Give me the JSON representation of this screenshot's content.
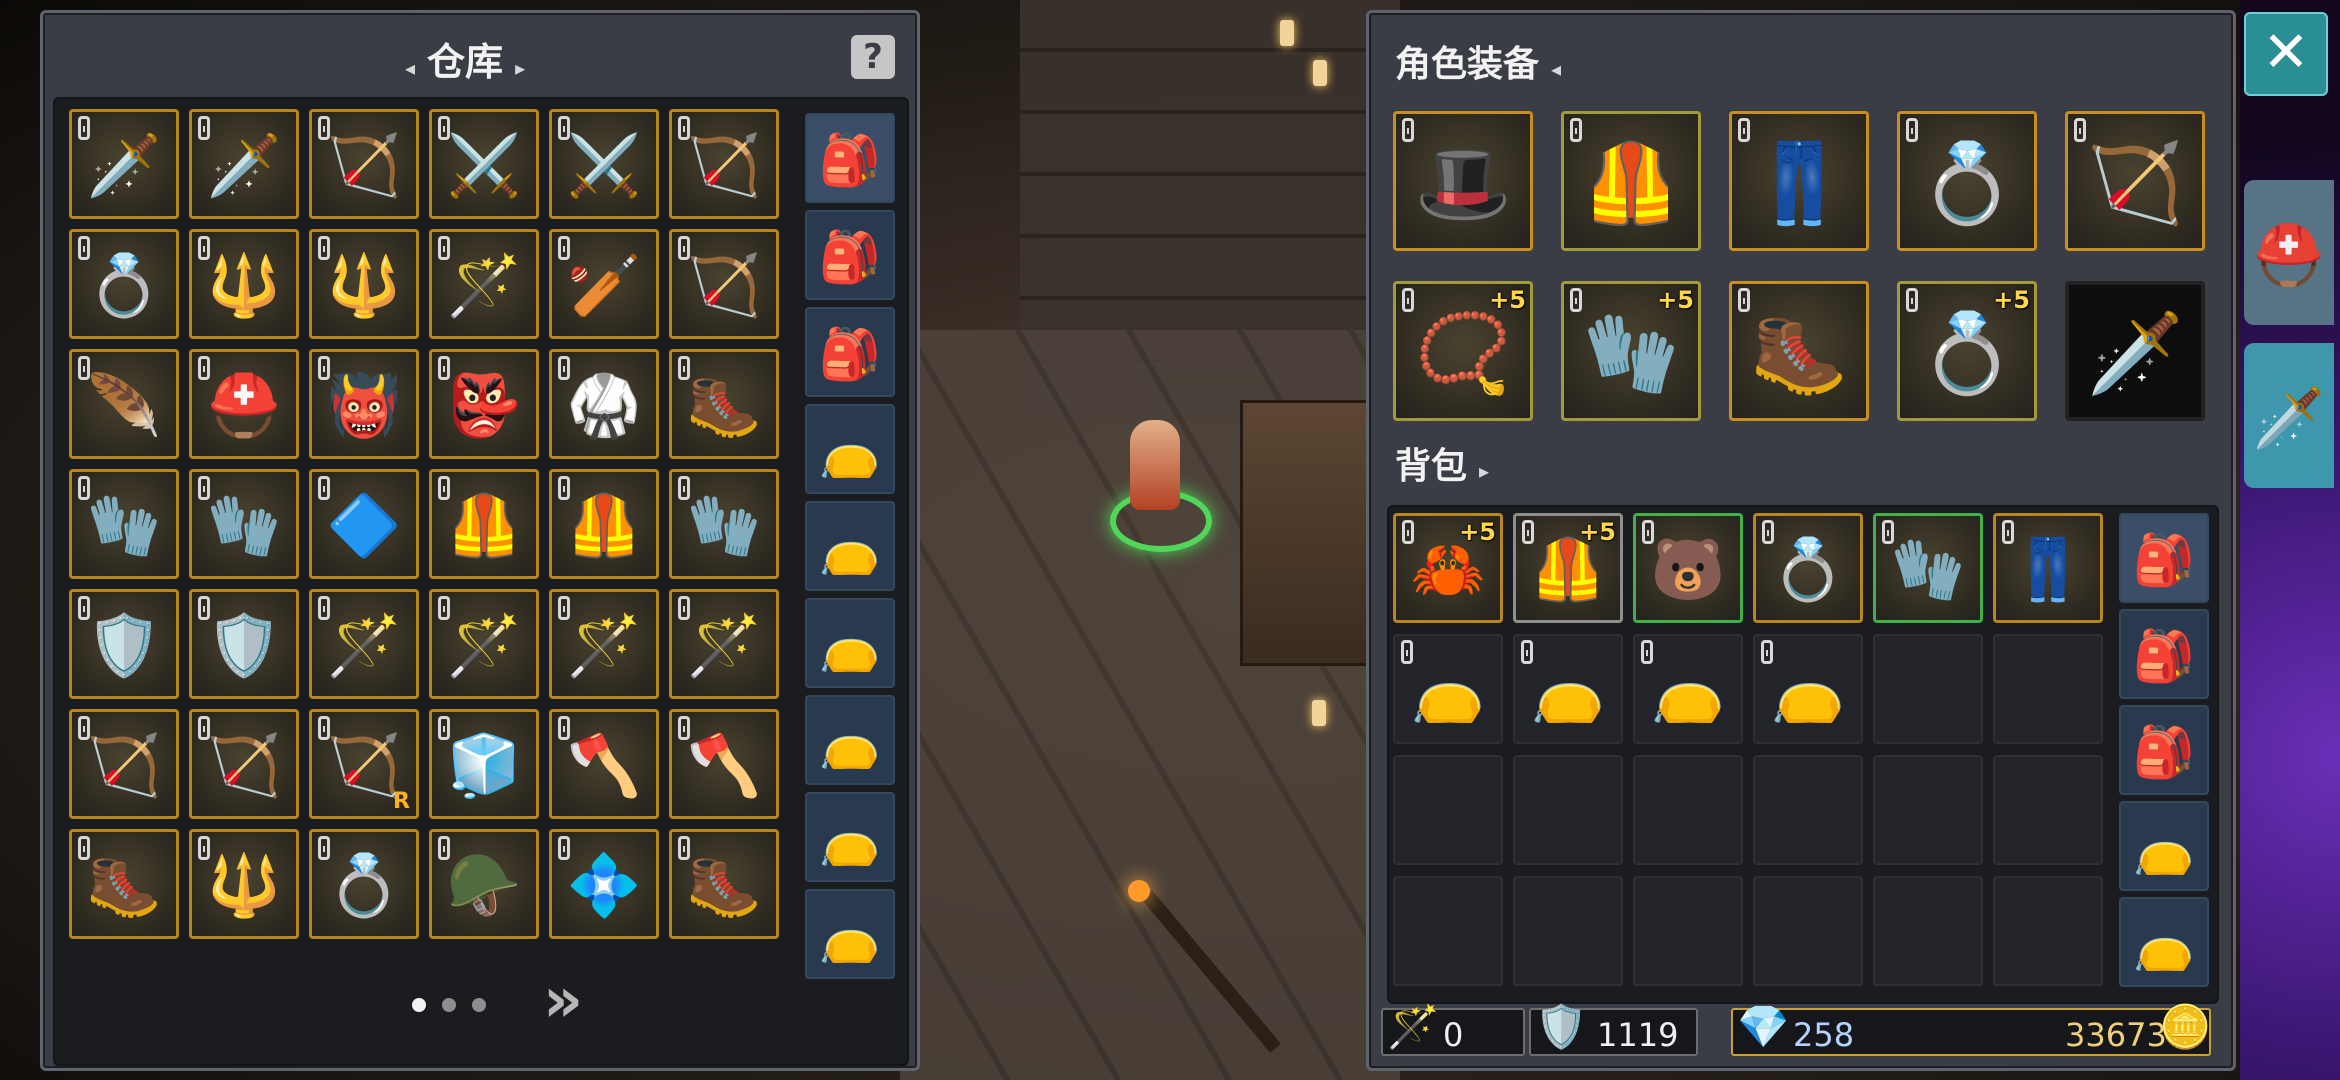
{
  "colors": {
    "gold_border": "#b8861c",
    "green_border": "#41b24a",
    "panel_bg": "#3a3d45",
    "close_bg": "#2a8f94",
    "plus_color": "#ffd54a"
  },
  "warehouse": {
    "title": "仓库",
    "help_label": "?",
    "page_count": 3,
    "current_page": 1,
    "next_label": "»",
    "grid": [
      [
        {
          "icon": "sword-icon",
          "glyph": "🗡️"
        },
        {
          "icon": "red-sword-icon",
          "glyph": "🗡️"
        },
        {
          "icon": "bow-icon",
          "glyph": "🏹"
        },
        {
          "icon": "greatsword-icon",
          "glyph": "⚔️"
        },
        {
          "icon": "greatsword-icon",
          "glyph": "⚔️"
        },
        {
          "icon": "dark-bow-icon",
          "glyph": "🏹"
        }
      ],
      [
        {
          "icon": "ruby-ring-icon",
          "glyph": "💍"
        },
        {
          "icon": "spear-icon",
          "glyph": "🔱"
        },
        {
          "icon": "spear-icon",
          "glyph": "🔱"
        },
        {
          "icon": "mace-staff-icon",
          "glyph": "🪄"
        },
        {
          "icon": "club-icon",
          "glyph": "🏏"
        },
        {
          "icon": "crimson-bow-icon",
          "glyph": "🏹"
        }
      ],
      [
        {
          "icon": "feather-staff-icon",
          "glyph": "🪶"
        },
        {
          "icon": "knight-helmet-icon",
          "glyph": "⛑️"
        },
        {
          "icon": "horned-helmet-icon",
          "glyph": "👹"
        },
        {
          "icon": "demon-helmet-icon",
          "glyph": "👺"
        },
        {
          "icon": "robe-armor-icon",
          "glyph": "🥋"
        },
        {
          "icon": "boots-icon",
          "glyph": "🥾"
        }
      ],
      [
        {
          "icon": "gauntlet-icon",
          "glyph": "🧤"
        },
        {
          "icon": "gauntlet-icon",
          "glyph": "🧤"
        },
        {
          "icon": "crystal-amulet-icon",
          "glyph": "🔷"
        },
        {
          "icon": "chest-armor-icon",
          "glyph": "🦺"
        },
        {
          "icon": "chest-armor-icon",
          "glyph": "🦺"
        },
        {
          "icon": "dark-gauntlet-icon",
          "glyph": "🧤"
        }
      ],
      [
        {
          "icon": "shield-icon",
          "glyph": "🛡️"
        },
        {
          "icon": "shield-icon",
          "glyph": "🛡️"
        },
        {
          "icon": "red-staff-icon",
          "glyph": "🪄"
        },
        {
          "icon": "red-staff-icon",
          "glyph": "🪄"
        },
        {
          "icon": "blue-staff-icon",
          "glyph": "🪄"
        },
        {
          "icon": "crimson-staff-icon",
          "glyph": "🪄"
        }
      ],
      [
        {
          "icon": "crossbow-icon",
          "glyph": "🏹"
        },
        {
          "icon": "crossbow-icon",
          "glyph": "🏹"
        },
        {
          "icon": "crossbow-icon",
          "glyph": "🏹",
          "rank": "R"
        },
        {
          "icon": "frost-armor-icon",
          "glyph": "🧊"
        },
        {
          "icon": "axe-icon",
          "glyph": "🪓"
        },
        {
          "icon": "axe-icon",
          "glyph": "🪓"
        }
      ],
      [
        {
          "icon": "purple-boots-icon",
          "glyph": "🥾"
        },
        {
          "icon": "dark-spear-icon",
          "glyph": "🔱"
        },
        {
          "icon": "gold-ring-icon",
          "glyph": "💍"
        },
        {
          "icon": "dark-helmet-icon",
          "glyph": "🪖"
        },
        {
          "icon": "emerald-amulet-icon",
          "glyph": "💠"
        },
        {
          "icon": "pink-boots-icon",
          "glyph": "🥾"
        }
      ]
    ],
    "bags": [
      {
        "icon": "large-bag-icon",
        "glyph": "🎒"
      },
      {
        "icon": "backpack-icon",
        "glyph": "🎒"
      },
      {
        "icon": "backpack-icon",
        "glyph": "🎒"
      },
      {
        "icon": "pouch-icon",
        "glyph": "👝"
      },
      {
        "icon": "pouch-icon",
        "glyph": "👝"
      },
      {
        "icon": "pouch-icon",
        "glyph": "👝"
      },
      {
        "icon": "pouch-icon",
        "glyph": "👝"
      },
      {
        "icon": "pouch-icon",
        "glyph": "👝"
      },
      {
        "icon": "pouch-icon",
        "glyph": "👝"
      }
    ]
  },
  "equipment": {
    "title": "角色装备",
    "row1": [
      {
        "icon": "hat-icon",
        "glyph": "🎩"
      },
      {
        "icon": "armor-icon",
        "glyph": "🦺",
        "tier": "olive"
      },
      {
        "icon": "pants-icon",
        "glyph": "👖"
      },
      {
        "icon": "ring-icon",
        "glyph": "💍"
      },
      {
        "icon": "bow-icon",
        "glyph": "🏹"
      }
    ],
    "row2": [
      {
        "icon": "amulet-icon",
        "glyph": "📿",
        "plus": "+5",
        "tier": "olive"
      },
      {
        "icon": "glove-icon",
        "glyph": "🧤",
        "plus": "+5",
        "tier": "olive"
      },
      {
        "icon": "boots-icon",
        "glyph": "🥾"
      },
      {
        "icon": "gem-ring-icon",
        "glyph": "💍",
        "plus": "+5",
        "tier": "olive"
      },
      {
        "icon": "weapon-slot-icon",
        "glyph": "🗡️",
        "tier": "dark"
      }
    ]
  },
  "backpack": {
    "title": "背包",
    "items": [
      {
        "icon": "blue-claw-icon",
        "glyph": "🦀",
        "plus": "+5",
        "border": "gold"
      },
      {
        "icon": "armor-icon",
        "glyph": "🦺",
        "plus": "+5",
        "border": "gray"
      },
      {
        "icon": "bear-hood-icon",
        "glyph": "🐻",
        "border": "green"
      },
      {
        "icon": "gem-ring-icon",
        "glyph": "💍",
        "border": "gold"
      },
      {
        "icon": "red-glove-icon",
        "glyph": "🧤",
        "border": "green"
      },
      {
        "icon": "pants-icon",
        "glyph": "👖",
        "border": "gold"
      },
      {
        "icon": "coin-pouch-icon",
        "glyph": "👝",
        "border": "empty"
      },
      {
        "icon": "coin-pouch-icon",
        "glyph": "👝",
        "border": "empty"
      },
      {
        "icon": "coin-pouch-icon",
        "glyph": "👝",
        "border": "empty"
      },
      {
        "icon": "coin-pouch-icon",
        "glyph": "👝",
        "border": "empty"
      }
    ],
    "bags": [
      {
        "icon": "large-bag-icon",
        "glyph": "🎒"
      },
      {
        "icon": "backpack-icon",
        "glyph": "🎒"
      },
      {
        "icon": "backpack-icon",
        "glyph": "🎒"
      },
      {
        "icon": "pouch-icon",
        "glyph": "👝"
      },
      {
        "icon": "pouch-icon",
        "glyph": "👝"
      }
    ]
  },
  "currencies": [
    {
      "icon": "wand-icon",
      "glyph": "🪄",
      "value": "0"
    },
    {
      "icon": "heart-shield-icon",
      "glyph": "🛡️",
      "value": "1119"
    },
    {
      "icon": "purple-crystal-icon",
      "glyph": "💎",
      "value": "258",
      "value2": "33673",
      "icon2": "gold-coin-icon",
      "glyph2": "🪙"
    }
  ],
  "close_label": "✕",
  "side_tabs": [
    {
      "icon": "helmet-icon",
      "glyph": "⛑️"
    },
    {
      "icon": "sword-tab-icon",
      "glyph": "🗡️"
    }
  ]
}
